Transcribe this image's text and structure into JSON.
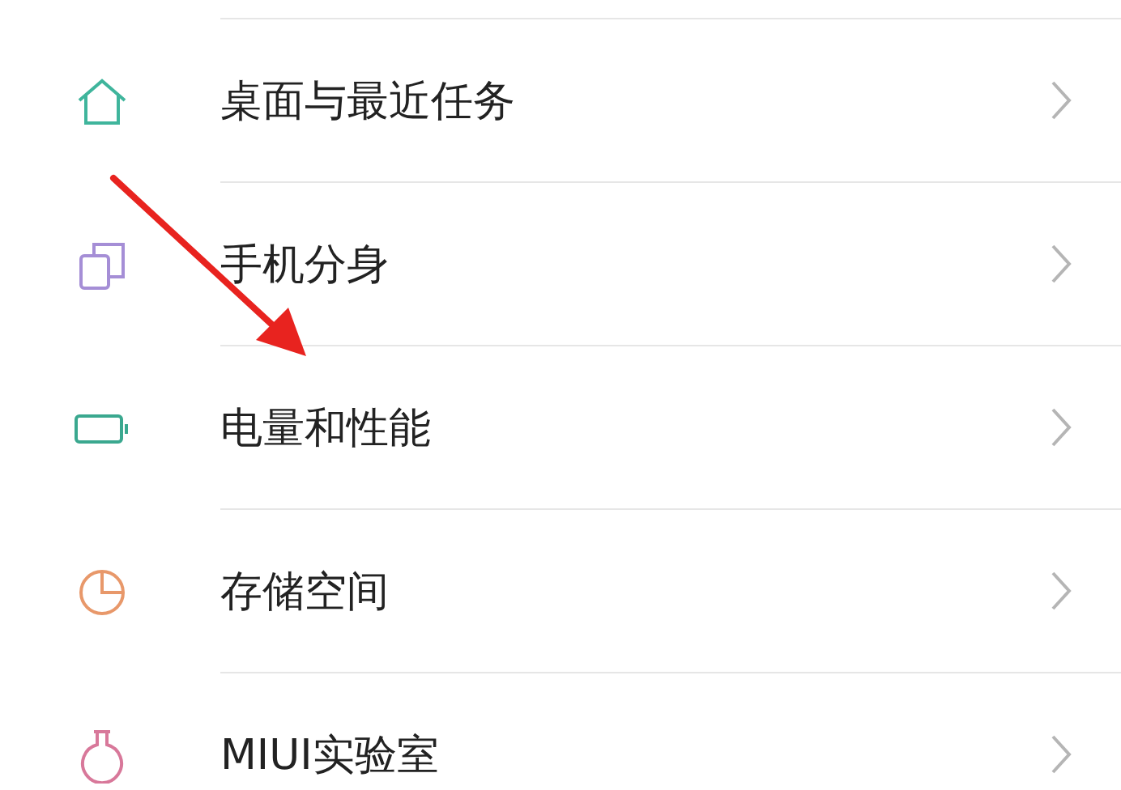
{
  "settings_items": [
    {
      "kind": "home",
      "color": "#3fb59c",
      "label": "桌面与最近任务"
    },
    {
      "kind": "clone",
      "color": "#a58ed6",
      "label": "手机分身"
    },
    {
      "kind": "battery",
      "color": "#3aa88f",
      "label": "电量和性能"
    },
    {
      "kind": "pie",
      "color": "#e8986a",
      "label": "存储空间"
    },
    {
      "kind": "flask",
      "color": "#d8789a",
      "label": "MIUI实验室"
    }
  ]
}
